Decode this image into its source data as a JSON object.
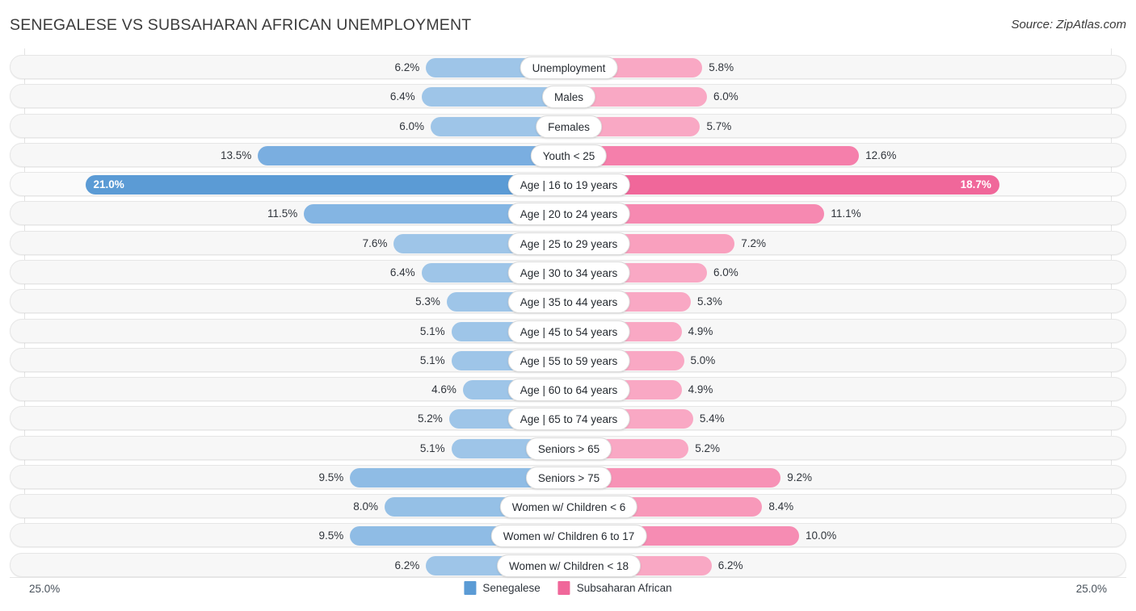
{
  "header": {
    "title": "SENEGALESE VS SUBSAHARAN AFRICAN UNEMPLOYMENT",
    "source": "Source: ZipAtlas.com"
  },
  "axis": {
    "left_label": "25.0%",
    "right_label": "25.0%",
    "max": 25.0
  },
  "legend": {
    "items": [
      {
        "label": "Senegalese",
        "color": "#5b9bd5"
      },
      {
        "label": "Subsaharan African",
        "color": "#f0679a"
      }
    ]
  },
  "chart_data": {
    "type": "bar",
    "orientation": "horizontal-diverging",
    "title": "SENEGALESE VS SUBSAHARAN AFRICAN UNEMPLOYMENT",
    "xlabel": "",
    "ylabel": "",
    "xlim": [
      25.0,
      25.0
    ],
    "grid": true,
    "legend_position": "bottom-center",
    "categories": [
      "Unemployment",
      "Males",
      "Females",
      "Youth < 25",
      "Age | 16 to 19 years",
      "Age | 20 to 24 years",
      "Age | 25 to 29 years",
      "Age | 30 to 34 years",
      "Age | 35 to 44 years",
      "Age | 45 to 54 years",
      "Age | 55 to 59 years",
      "Age | 60 to 64 years",
      "Age | 65 to 74 years",
      "Seniors > 65",
      "Seniors > 75",
      "Women w/ Children < 6",
      "Women w/ Children 6 to 17",
      "Women w/ Children < 18"
    ],
    "series": [
      {
        "name": "Senegalese",
        "side": "left",
        "values": [
          6.2,
          6.4,
          6.0,
          13.5,
          21.0,
          11.5,
          7.6,
          6.4,
          5.3,
          5.1,
          5.1,
          4.6,
          5.2,
          5.1,
          9.5,
          8.0,
          9.5,
          6.2
        ],
        "labels": [
          "6.2%",
          "6.4%",
          "6.0%",
          "13.5%",
          "21.0%",
          "11.5%",
          "7.6%",
          "6.4%",
          "5.3%",
          "5.1%",
          "5.1%",
          "4.6%",
          "5.2%",
          "5.1%",
          "9.5%",
          "8.0%",
          "9.5%",
          "6.2%"
        ]
      },
      {
        "name": "Subsaharan African",
        "side": "right",
        "values": [
          5.8,
          6.0,
          5.7,
          12.6,
          18.7,
          11.1,
          7.2,
          6.0,
          5.3,
          4.9,
          5.0,
          4.9,
          5.4,
          5.2,
          9.2,
          8.4,
          10.0,
          6.2
        ],
        "labels": [
          "5.8%",
          "6.0%",
          "5.7%",
          "12.6%",
          "18.7%",
          "11.1%",
          "7.2%",
          "6.0%",
          "5.3%",
          "4.9%",
          "5.0%",
          "4.9%",
          "5.4%",
          "5.2%",
          "9.2%",
          "8.4%",
          "10.0%",
          "6.2%"
        ]
      }
    ]
  },
  "rows": [
    {
      "label": "Unemployment",
      "left_value": 6.2,
      "left_label": "6.2%",
      "right_value": 5.8,
      "right_label": "5.8%",
      "left_color": "#9ec5e8",
      "right_color": "#f9a8c4",
      "highlight": false
    },
    {
      "label": "Males",
      "left_value": 6.4,
      "left_label": "6.4%",
      "right_value": 6.0,
      "right_label": "6.0%",
      "left_color": "#9ec5e8",
      "right_color": "#f9a8c4",
      "highlight": false
    },
    {
      "label": "Females",
      "left_value": 6.0,
      "left_label": "6.0%",
      "right_value": 5.7,
      "right_label": "5.7%",
      "left_color": "#9ec5e8",
      "right_color": "#f9a8c4",
      "highlight": false
    },
    {
      "label": "Youth < 25",
      "left_value": 13.5,
      "left_label": "13.5%",
      "right_value": 12.6,
      "right_label": "12.6%",
      "left_color": "#7aaee0",
      "right_color": "#f57fab",
      "highlight": false
    },
    {
      "label": "Age | 16 to 19 years",
      "left_value": 21.0,
      "left_label": "21.0%",
      "right_value": 18.7,
      "right_label": "18.7%",
      "left_color": "#5b9bd5",
      "right_color": "#f0679a",
      "highlight": true
    },
    {
      "label": "Age | 20 to 24 years",
      "left_value": 11.5,
      "left_label": "11.5%",
      "right_value": 11.1,
      "right_label": "11.1%",
      "left_color": "#84b5e3",
      "right_color": "#f689b1",
      "highlight": false
    },
    {
      "label": "Age | 25 to 29 years",
      "left_value": 7.6,
      "left_label": "7.6%",
      "right_value": 7.2,
      "right_label": "7.2%",
      "left_color": "#9ec5e8",
      "right_color": "#f9a0be",
      "highlight": false
    },
    {
      "label": "Age | 30 to 34 years",
      "left_value": 6.4,
      "left_label": "6.4%",
      "right_value": 6.0,
      "right_label": "6.0%",
      "left_color": "#9ec5e8",
      "right_color": "#f9a8c4",
      "highlight": false
    },
    {
      "label": "Age | 35 to 44 years",
      "left_value": 5.3,
      "left_label": "5.3%",
      "right_value": 5.3,
      "right_label": "5.3%",
      "left_color": "#9ec5e8",
      "right_color": "#f9a8c4",
      "highlight": false
    },
    {
      "label": "Age | 45 to 54 years",
      "left_value": 5.1,
      "left_label": "5.1%",
      "right_value": 4.9,
      "right_label": "4.9%",
      "left_color": "#9ec5e8",
      "right_color": "#f9a8c4",
      "highlight": false
    },
    {
      "label": "Age | 55 to 59 years",
      "left_value": 5.1,
      "left_label": "5.1%",
      "right_value": 5.0,
      "right_label": "5.0%",
      "left_color": "#9ec5e8",
      "right_color": "#f9a8c4",
      "highlight": false
    },
    {
      "label": "Age | 60 to 64 years",
      "left_value": 4.6,
      "left_label": "4.6%",
      "right_value": 4.9,
      "right_label": "4.9%",
      "left_color": "#9ec5e8",
      "right_color": "#f9a8c4",
      "highlight": false
    },
    {
      "label": "Age | 65 to 74 years",
      "left_value": 5.2,
      "left_label": "5.2%",
      "right_value": 5.4,
      "right_label": "5.4%",
      "left_color": "#9ec5e8",
      "right_color": "#f9a8c4",
      "highlight": false
    },
    {
      "label": "Seniors > 65",
      "left_value": 5.1,
      "left_label": "5.1%",
      "right_value": 5.2,
      "right_label": "5.2%",
      "left_color": "#9ec5e8",
      "right_color": "#f9a8c4",
      "highlight": false
    },
    {
      "label": "Seniors > 75",
      "left_value": 9.5,
      "left_label": "9.5%",
      "right_value": 9.2,
      "right_label": "9.2%",
      "left_color": "#8fbce5",
      "right_color": "#f792b6",
      "highlight": false
    },
    {
      "label": "Women w/ Children < 6",
      "left_value": 8.0,
      "left_label": "8.0%",
      "right_value": 8.4,
      "right_label": "8.4%",
      "left_color": "#95c0e6",
      "right_color": "#f899ba",
      "highlight": false
    },
    {
      "label": "Women w/ Children 6 to 17",
      "left_value": 9.5,
      "left_label": "9.5%",
      "right_value": 10.0,
      "right_label": "10.0%",
      "left_color": "#8fbce5",
      "right_color": "#f68cb3",
      "highlight": false
    },
    {
      "label": "Women w/ Children < 18",
      "left_value": 6.2,
      "left_label": "6.2%",
      "right_value": 6.2,
      "right_label": "6.2%",
      "left_color": "#9ec5e8",
      "right_color": "#f9a8c4",
      "highlight": false
    }
  ]
}
